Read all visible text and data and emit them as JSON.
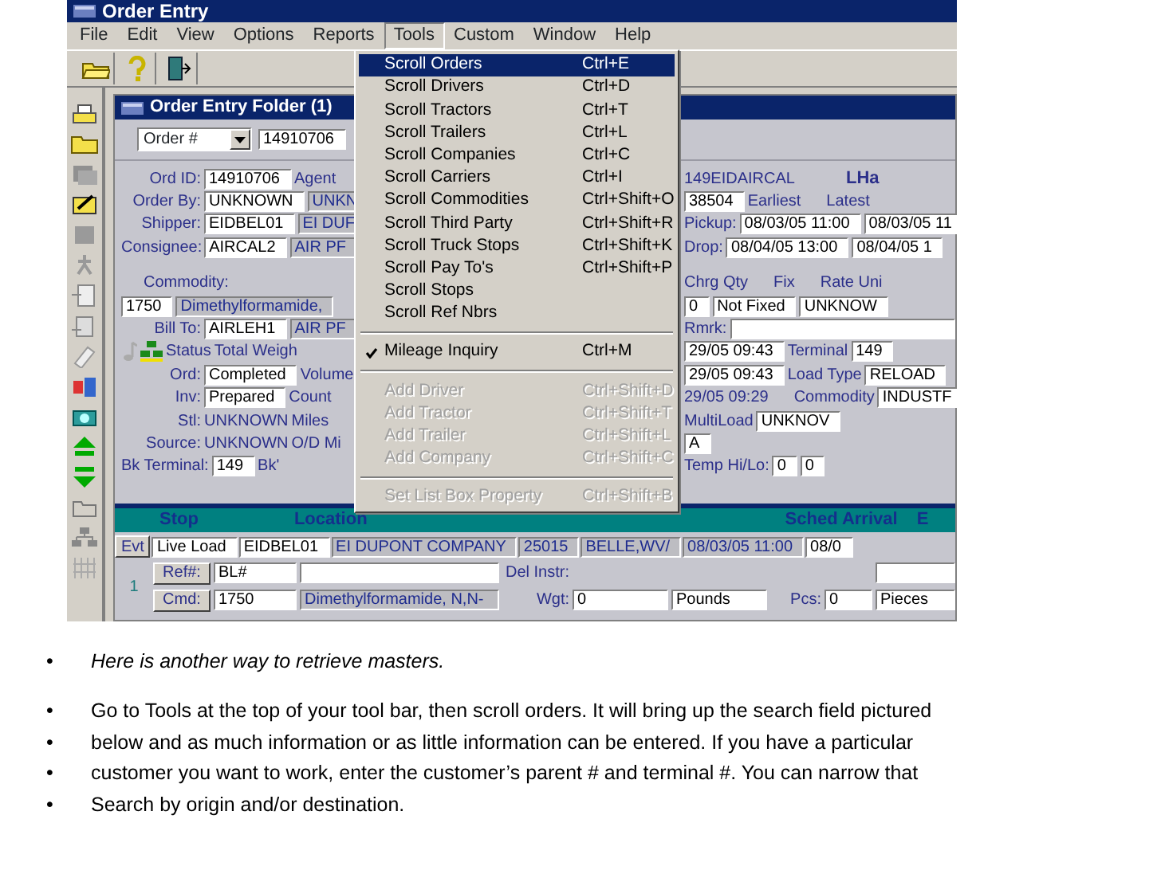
{
  "app_window": {
    "title": "Order Entry"
  },
  "menu_bar": [
    {
      "label": "File",
      "selected": false
    },
    {
      "label": "Edit",
      "selected": false
    },
    {
      "label": "View",
      "selected": false
    },
    {
      "label": "Options",
      "selected": false
    },
    {
      "label": "Reports",
      "selected": false
    },
    {
      "label": "Tools",
      "selected": true
    },
    {
      "label": "Custom",
      "selected": false
    },
    {
      "label": "Window",
      "selected": false
    },
    {
      "label": "Help",
      "selected": false
    }
  ],
  "tools_menu": [
    {
      "kind": "item",
      "label": "Scroll Orders",
      "shortcut": "Ctrl+E",
      "selected": true,
      "disabled": false,
      "checked": false
    },
    {
      "kind": "item",
      "label": "Scroll Drivers",
      "shortcut": "Ctrl+D",
      "selected": false,
      "disabled": false,
      "checked": false
    },
    {
      "kind": "item",
      "label": "Scroll Tractors",
      "shortcut": "Ctrl+T",
      "selected": false,
      "disabled": false,
      "checked": false
    },
    {
      "kind": "item",
      "label": "Scroll Trailers",
      "shortcut": "Ctrl+L",
      "selected": false,
      "disabled": false,
      "checked": false
    },
    {
      "kind": "item",
      "label": "Scroll Companies",
      "shortcut": "Ctrl+C",
      "selected": false,
      "disabled": false,
      "checked": false
    },
    {
      "kind": "item",
      "label": "Scroll Carriers",
      "shortcut": "Ctrl+I",
      "selected": false,
      "disabled": false,
      "checked": false
    },
    {
      "kind": "item",
      "label": "Scroll Commodities",
      "shortcut": "Ctrl+Shift+O",
      "selected": false,
      "disabled": false,
      "checked": false
    },
    {
      "kind": "item",
      "label": "Scroll Third Party",
      "shortcut": "Ctrl+Shift+R",
      "selected": false,
      "disabled": false,
      "checked": false
    },
    {
      "kind": "item",
      "label": "Scroll Truck Stops",
      "shortcut": "Ctrl+Shift+K",
      "selected": false,
      "disabled": false,
      "checked": false
    },
    {
      "kind": "item",
      "label": "Scroll Pay To's",
      "shortcut": "Ctrl+Shift+P",
      "selected": false,
      "disabled": false,
      "checked": false
    },
    {
      "kind": "item",
      "label": "Scroll Stops",
      "selected": false,
      "disabled": false,
      "checked": false
    },
    {
      "kind": "item",
      "label": "Scroll Ref Nbrs",
      "selected": false,
      "disabled": false,
      "checked": false
    },
    {
      "kind": "separator"
    },
    {
      "kind": "item",
      "label": "Mileage Inquiry",
      "shortcut": "Ctrl+M",
      "selected": false,
      "disabled": false,
      "checked": true
    },
    {
      "kind": "separator"
    },
    {
      "kind": "item",
      "label": "Add Driver",
      "shortcut": "Ctrl+Shift+D",
      "selected": false,
      "disabled": true,
      "checked": false
    },
    {
      "kind": "item",
      "label": "Add Tractor",
      "shortcut": "Ctrl+Shift+T",
      "selected": false,
      "disabled": true,
      "checked": false
    },
    {
      "kind": "item",
      "label": "Add Trailer",
      "shortcut": "Ctrl+Shift+L",
      "selected": false,
      "disabled": true,
      "checked": false
    },
    {
      "kind": "item",
      "label": "Add Company",
      "shortcut": "Ctrl+Shift+C",
      "selected": false,
      "disabled": true,
      "checked": false
    },
    {
      "kind": "separator"
    },
    {
      "kind": "item",
      "label": "Set List Box Property",
      "shortcut": "Ctrl+Shift+B",
      "selected": false,
      "disabled": true,
      "checked": false
    }
  ],
  "folder_window": {
    "title": "Order Entry Folder (1)",
    "search_type": "Order #",
    "search_value": "14910706"
  },
  "form_left": [
    [
      {
        "kind": "label",
        "text": "Ord ID:"
      },
      {
        "kind": "field",
        "text": "14910706"
      },
      {
        "kind": "label",
        "text": "Agent"
      }
    ],
    [
      {
        "kind": "label",
        "text": "Order By:"
      },
      {
        "kind": "field",
        "text": "UNKNOWN"
      },
      {
        "kind": "readonly",
        "text": "UNKN"
      }
    ],
    [
      {
        "kind": "label",
        "text": "Shipper:"
      },
      {
        "kind": "field",
        "text": "EIDBEL01"
      },
      {
        "kind": "readonly",
        "text": "EI DUF"
      }
    ],
    [
      {
        "kind": "label",
        "text": "Consignee:"
      },
      {
        "kind": "field",
        "text": "AIRCAL2"
      },
      {
        "kind": "readonly",
        "text": "AIR PF"
      }
    ],
    [
      {
        "kind": "gap"
      }
    ],
    [
      {
        "kind": "heading",
        "text": "Commodity:"
      }
    ],
    [
      {
        "kind": "field",
        "text": "1750"
      },
      {
        "kind": "readonly",
        "text": "Dimethylformamide,"
      }
    ],
    [
      {
        "kind": "label",
        "text": "Bill To:"
      },
      {
        "kind": "field",
        "text": "AIRLEH1"
      },
      {
        "kind": "readonly",
        "text": "AIR PF"
      }
    ],
    [
      {
        "kind": "note-icon"
      },
      {
        "kind": "network-icon"
      },
      {
        "kind": "value",
        "text": "Status"
      },
      {
        "kind": "value",
        "text": "Total Weigh"
      }
    ],
    [
      {
        "kind": "label",
        "text": "Ord:"
      },
      {
        "kind": "field",
        "text": "Completed"
      },
      {
        "kind": "value",
        "text": "Volume"
      }
    ],
    [
      {
        "kind": "label",
        "text": "Inv:"
      },
      {
        "kind": "field",
        "text": "Prepared"
      },
      {
        "kind": "value",
        "text": "Count"
      }
    ],
    [
      {
        "kind": "label",
        "text": "Stl:"
      },
      {
        "kind": "value",
        "text": "UNKNOWN"
      },
      {
        "kind": "value",
        "text": "Miles"
      }
    ],
    [
      {
        "kind": "label",
        "text": "Source:"
      },
      {
        "kind": "value",
        "text": "UNKNOWN"
      },
      {
        "kind": "value",
        "text": "O/D Mi"
      }
    ],
    [
      {
        "kind": "label",
        "text": "Bk Terminal:"
      },
      {
        "kind": "field",
        "text": "149"
      },
      {
        "kind": "value",
        "text": "Bk'"
      }
    ]
  ],
  "form_right": [
    [
      {
        "kind": "value",
        "text": "149EIDAIRCAL"
      },
      {
        "kind": "heading",
        "text": "LHa"
      }
    ],
    [
      {
        "kind": "field",
        "text": "38504"
      },
      {
        "kind": "value",
        "text": "Earliest"
      },
      {
        "kind": "value",
        "text": "Latest"
      }
    ],
    [
      {
        "kind": "label",
        "text": "Pickup:"
      },
      {
        "kind": "field",
        "text": "08/03/05 11:00"
      },
      {
        "kind": "field",
        "text": "08/03/05 11"
      }
    ],
    [
      {
        "kind": "label",
        "text": "Drop:"
      },
      {
        "kind": "field",
        "text": "08/04/05 13:00"
      },
      {
        "kind": "field",
        "text": "08/04/05 1"
      }
    ],
    [
      {
        "kind": "gap"
      }
    ],
    [
      {
        "kind": "value",
        "text": "Chrg Qty"
      },
      {
        "kind": "value",
        "text": "Fix"
      },
      {
        "kind": "value",
        "text": "Rate Uni"
      }
    ],
    [
      {
        "kind": "field",
        "text": "0"
      },
      {
        "kind": "field",
        "text": "Not Fixed"
      },
      {
        "kind": "field",
        "text": "UNKNOW"
      }
    ],
    [
      {
        "kind": "label",
        "text": "Rmrk:"
      },
      {
        "kind": "field"
      }
    ],
    [
      {
        "kind": "field",
        "text": "29/05 09:43"
      },
      {
        "kind": "label",
        "text": "Terminal"
      },
      {
        "kind": "field",
        "text": "149"
      }
    ],
    [
      {
        "kind": "field",
        "text": "29/05 09:43"
      },
      {
        "kind": "label",
        "text": "Load Type"
      },
      {
        "kind": "field",
        "text": "RELOAD"
      }
    ],
    [
      {
        "kind": "value",
        "text": "29/05 09:29"
      },
      {
        "kind": "label",
        "text": "Commodity"
      },
      {
        "kind": "field",
        "text": "INDUSTF"
      }
    ],
    [
      {
        "kind": "label",
        "text": "MultiLoad"
      },
      {
        "kind": "field",
        "text": "UNKNOV"
      }
    ],
    [
      {
        "kind": "field",
        "text": "A"
      }
    ],
    [
      {
        "kind": "label",
        "text": "Temp Hi/Lo:"
      },
      {
        "kind": "field",
        "text": "0"
      },
      {
        "kind": "field",
        "text": "0"
      }
    ]
  ],
  "stops_grid": {
    "columns": [
      "Stop",
      "Location",
      "Sched Arrival",
      "E"
    ],
    "event_row": [
      {
        "kind": "button",
        "text": "Evt"
      },
      {
        "kind": "field",
        "text": "Live Load"
      },
      {
        "kind": "field",
        "text": "EIDBEL01"
      },
      {
        "kind": "readonly",
        "text": "EI DUPONT COMPANY"
      },
      {
        "kind": "readonly",
        "text": "25015"
      },
      {
        "kind": "readonly",
        "text": "BELLE,WV/"
      },
      {
        "kind": "readonly",
        "text": "08/03/05 11:00"
      },
      {
        "kind": "field",
        "text": "08/0"
      }
    ],
    "stop": {
      "number": "1",
      "rows": [
        [
          {
            "kind": "button",
            "text": "Ref#:"
          },
          {
            "kind": "field",
            "text": "BL#"
          },
          {
            "kind": "field"
          },
          {
            "kind": "label",
            "text": "Del Instr:"
          },
          {
            "kind": "field"
          }
        ],
        [
          {
            "kind": "button",
            "text": "Cmd:"
          },
          {
            "kind": "field",
            "text": "1750"
          },
          {
            "kind": "readonly",
            "text": "Dimethylformamide, N,N-"
          },
          {
            "kind": "label",
            "text": "Wgt:"
          },
          {
            "kind": "field",
            "text": "0"
          },
          {
            "kind": "field",
            "text": "Pounds"
          },
          {
            "kind": "label",
            "text": "Pcs:"
          },
          {
            "kind": "field",
            "text": "0"
          },
          {
            "kind": "field",
            "text": "Pieces"
          }
        ]
      ]
    }
  },
  "notes": [
    [
      {
        "marker": "•",
        "text": "Here is another way to retrieve masters.",
        "italic": true
      }
    ],
    [
      {
        "marker": "•",
        "text": "Go to Tools at the top of your tool bar, then scroll orders.  It will bring up the search field pictured",
        "italic": false
      },
      {
        "marker": "•",
        "text": "below and as much information or as little information can be entered.  If you have a particular",
        "italic": false
      },
      {
        "marker": "•",
        "text": "customer you want to work, enter the customer’s parent # and terminal #.   You can narrow that",
        "italic": false
      },
      {
        "marker": "•",
        "text": "Search by origin and/or destination.",
        "italic": false
      }
    ]
  ]
}
